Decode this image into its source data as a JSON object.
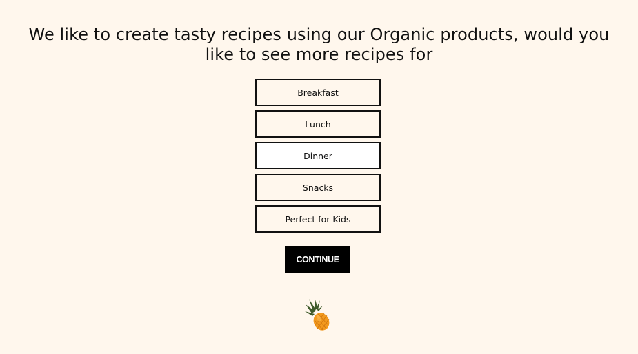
{
  "heading": "We like to create tasty recipes using our Organic products, would you like to see more recipes for",
  "options": [
    {
      "label": "Breakfast",
      "selected": false
    },
    {
      "label": "Lunch",
      "selected": false
    },
    {
      "label": "Dinner",
      "selected": true
    },
    {
      "label": "Snacks",
      "selected": false
    },
    {
      "label": "Perfect for Kids",
      "selected": false
    }
  ],
  "continue_label": "CONTINUE",
  "decoration": {
    "icon": "pineapple-icon"
  },
  "colors": {
    "background": "#fff7ed",
    "text": "#111111",
    "button_bg": "#000000",
    "button_text": "#ffffff",
    "selected_bg": "#ffffff",
    "pineapple_body": "#f39a1e",
    "pineapple_leaves": "#3e5a2a"
  }
}
